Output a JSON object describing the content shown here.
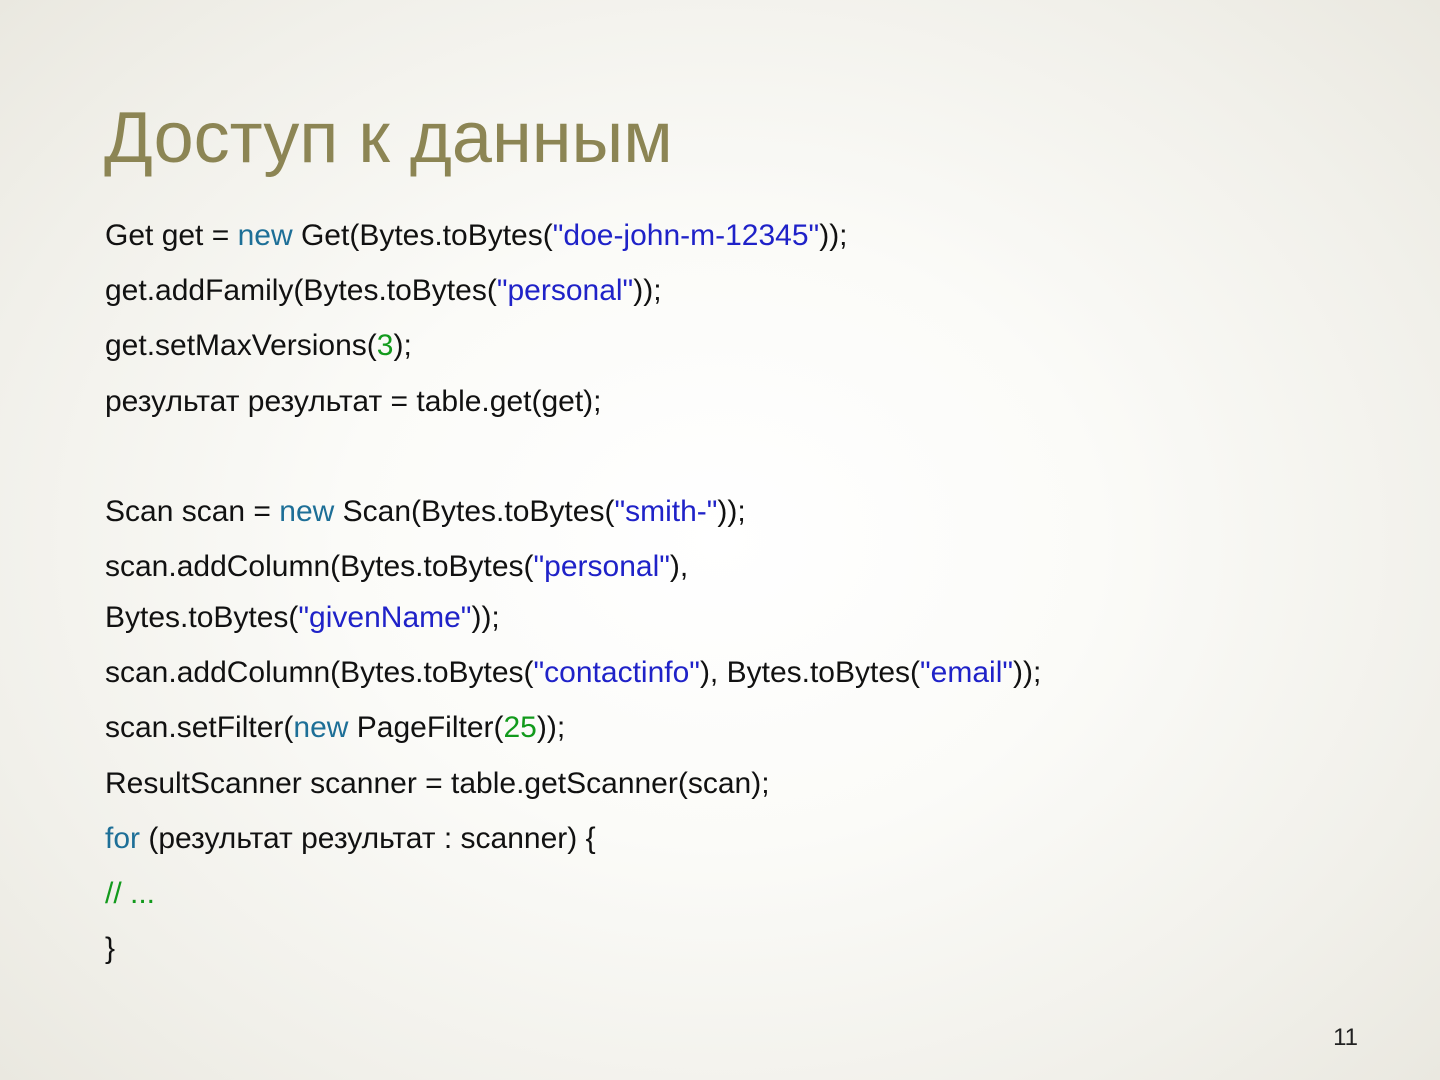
{
  "slide": {
    "title": "Доступ к данным",
    "page_number": "11"
  },
  "colors": {
    "title": "#8c8554",
    "keyword": "#1d6f97",
    "string": "#1f22c8",
    "number": "#129a1c",
    "comment": "#129a1c",
    "text": "#111111"
  },
  "code": {
    "l1": {
      "a": "Get get = ",
      "kw": "new",
      "b": " Get(Bytes.toBytes(",
      "s": "\"doe-john-m-12345\"",
      "c": "));"
    },
    "l2": {
      "a": "get.addFamily(Bytes.toBytes(",
      "s": "\"personal\"",
      "c": "));"
    },
    "l3": {
      "a": "get.setMaxVersions(",
      "n": "3",
      "c": ");"
    },
    "l4": {
      "a": "результат результат = table.get(get);"
    },
    "l5": {
      "a": "Scan scan = ",
      "kw": "new",
      "b": " Scan(Bytes.toBytes(",
      "s": "\"smith-\"",
      "c": "));"
    },
    "l6": {
      "a": "scan.addColumn(Bytes.toBytes(",
      "s": "\"personal\"",
      "c": "),"
    },
    "l7": {
      "a": "Bytes.toBytes(",
      "s": "\"givenName\"",
      "c": "));"
    },
    "l8": {
      "a": "scan.addColumn(Bytes.toBytes(",
      "s": "\"contactinfo\"",
      "b": "), Bytes.toBytes(",
      "s2": "\"email\"",
      "c": "));"
    },
    "l9": {
      "a": "scan.setFilter(",
      "kw": "new",
      "b": " PageFilter(",
      "n": "25",
      "c": "));"
    },
    "l10": {
      "a": "ResultScanner scanner = table.getScanner(scan);"
    },
    "l11": {
      "kw": "for",
      "a": " (результат результат : scanner) {"
    },
    "l12": {
      "cmt": "// ..."
    },
    "l13": {
      "a": "}"
    }
  }
}
